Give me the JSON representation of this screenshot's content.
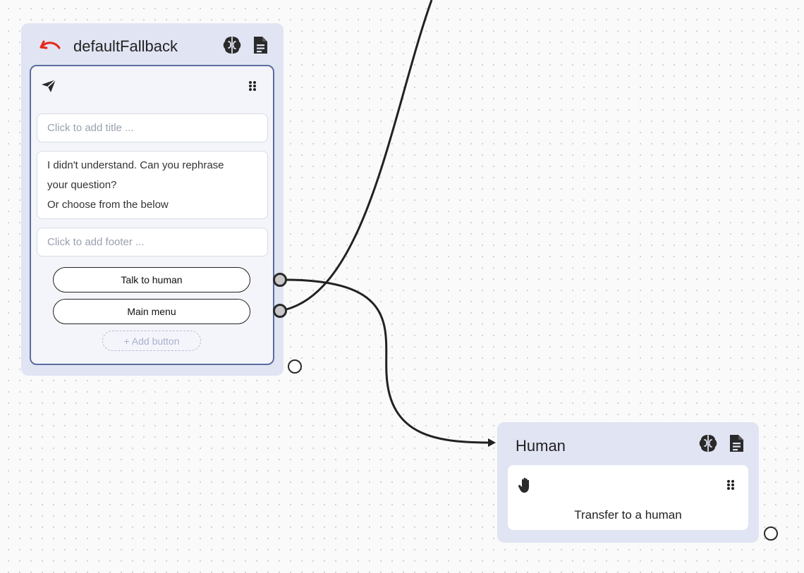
{
  "nodes": {
    "fallback": {
      "title": "defaultFallback",
      "title_icon": "undo-arrow-icon",
      "header_icons": [
        "brain-icon",
        "document-icon"
      ],
      "card_icon": "send-icon",
      "title_placeholder": "Click to add title ...",
      "body_lines": [
        "I didn't understand. Can you rephrase",
        "your question?",
        "Or choose from the below"
      ],
      "footer_placeholder": "Click to add footer ...",
      "buttons": [
        "Talk to human",
        "Main menu"
      ],
      "add_button_label": "+ Add button"
    },
    "human": {
      "title": "Human",
      "header_icons": [
        "brain-icon",
        "document-icon"
      ],
      "card_icon": "hand-icon",
      "action_text": "Transfer to a human"
    }
  },
  "colors": {
    "node_bg": "#e1e4f3",
    "card_border": "#5a6d9e",
    "undo_icon": "#e5271b",
    "edge": "#222222"
  }
}
